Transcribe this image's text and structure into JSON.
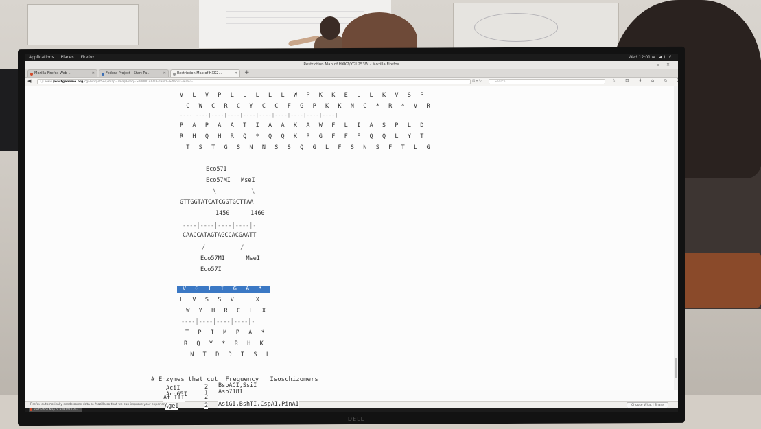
{
  "gnome": {
    "menus": [
      "Applications",
      "Places",
      "Firefox"
    ],
    "clock": "Wed 12:01",
    "tray": "⊞ ◀) ⏻"
  },
  "window": {
    "title": "Restriction Map of HXK2/YGL253W - Mozilla Firefox",
    "controls": "_ ▫ ✕"
  },
  "tabs": [
    {
      "label": "Mozilla Firefox Web ..."
    },
    {
      "label": "Fedora Project - Start Pa..."
    },
    {
      "label": "Restriction Map of HXK2..."
    }
  ],
  "newtab": "+",
  "nav": {
    "back": "◀",
    "url_prefix": "ⓘ www.",
    "url_domain": "yeastgenome.org",
    "url_rest": "/cgi-bin/getSeq?map=rmap&seq=S000003221&flankl=&flankr=&rev=",
    "reader": "⊡ ▾ ↻",
    "search_placeholder": "Search",
    "toolbar": "☆ ⊡ ⬇ ⌂ ◎ ☰"
  },
  "sequence_top": {
    "line1": "V L V P L L L L L W P K K E L L K V S P",
    "line2": " C W C R C Y C C F G P K K N C * R * V R",
    "ruler1": "----|----|----|----|----|----|----|----|----|----|",
    "line3": "P A P A A T I A A K A W F L I A S P L D",
    "line4": "R H Q H R Q * Q Q K P G F F F Q Q L Y T",
    "line5": " T S T G S N N S S Q G L F S N S F T L G"
  },
  "enzyme_map": {
    "top_e1": "Eco57I",
    "top_e2": "Eco57MI   MseI",
    "top_slash": "\\          \\",
    "seq": "GTTGGTATCATCGGTGCTTAA",
    "pos": "1450      1460",
    "ruler": "----|----|----|----|-",
    "comp": "CAACCATAGTAGCCACGAATT",
    "bot_slash": "/          /",
    "bot_e1": "Eco57MI      MseI",
    "bot_e2": "Eco57I"
  },
  "translation": {
    "selected": "V G I I G A *",
    "line2": "L V S S V L X",
    "line3": " W Y H R C L X",
    "ruler": "----|----|----|----|-",
    "line4": "T P I M P A *",
    "line5": "R Q Y * R H K",
    "line6": " N T D D T S L"
  },
  "enzymes_table": {
    "header": "# Enzymes that cut  Frequency   Isoschizomers",
    "rows": [
      {
        "name": "Acc65I",
        "freq": "1",
        "iso": "Asp718I"
      },
      {
        "name": "AciI",
        "freq": "2",
        "iso": "BspACI,SsiI"
      },
      {
        "name": "AflIII",
        "freq": "2",
        "iso": ""
      },
      {
        "name": "AgeI",
        "freq": "2",
        "iso": "AsiGI,BshTI,CspAI,PinAI"
      }
    ]
  },
  "notification": {
    "text": "Firefox automatically sends some data to Mozilla so that we can improve your experience.",
    "button": "Choose What I Share"
  },
  "taskbar": {
    "item": "Restriction Map of HXK2/YGL253..."
  },
  "stand_logo": "DELL"
}
